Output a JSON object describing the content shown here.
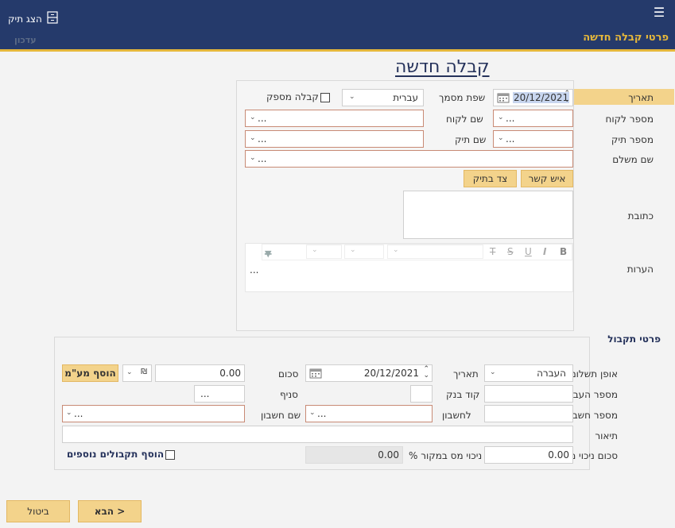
{
  "header": {
    "show_file": "הצג תיק",
    "title": "פרטי קבלה חדשה",
    "update": "עדכון"
  },
  "form": {
    "title": "קבלה חדשה"
  },
  "details": {
    "date_label": "תאריך",
    "date_value": "20/12/2021",
    "doc_lang_label": "שפת מסמך",
    "doc_lang_value": "עברית",
    "supplier_receipt_label": "קבלה מספק",
    "customer_number_label": "מספר לקוח",
    "customer_number_value": "...",
    "customer_name_label": "שם לקוח",
    "customer_name_value": "...",
    "file_number_label": "מספר תיק",
    "file_number_value": "...",
    "file_name_label": "שם תיק",
    "file_name_value": "...",
    "payer_name_label": "שם משלם",
    "payer_name_value": "...",
    "contact_button": "איש קשר",
    "party_button": "צד בתיק",
    "address_label": "כתובת",
    "notes_label": "הערות",
    "notes_value": "..."
  },
  "editor": {
    "bold": "B",
    "italic": "I",
    "underline": "U",
    "strike": "S",
    "clear": "T"
  },
  "receipt": {
    "section_title": "פרטי תקבול",
    "payment_method_label": "אופן תשלום",
    "payment_method_value": "העברה",
    "date_label": "תאריך",
    "date_value": "20/12/2021",
    "amount_label": "סכום",
    "amount_value": "0.00",
    "add_vat_button": "הוסף מע\"מ",
    "transfer_number_label": "מספר העברה",
    "bank_code_label": "קוד בנק",
    "branch_label": "סניף",
    "branch_btn": "...",
    "account_number_label": "מספר חשבון",
    "to_account_label": "לחשבון",
    "account_name_label": "שם חשבון",
    "account_name_left_value": "...",
    "to_account_value": "...",
    "description_label": "תיאור",
    "tax_deduction_label": "סכום ניכוי מס",
    "tax_deduction_value": "0.00",
    "tax_percent_label": "% ניכוי מס במקור",
    "tax_percent_value": "0.00",
    "add_more_label": "הוסף תקבולים נוספים"
  },
  "footer": {
    "next_button": "הבא >",
    "cancel_button": "ביטול"
  }
}
